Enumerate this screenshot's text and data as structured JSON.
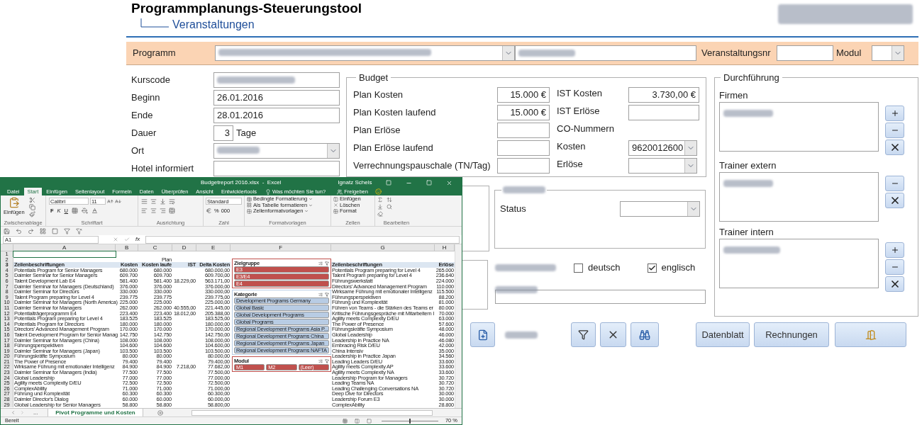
{
  "app": {
    "title": "Programmplanungs-Steuerungstool",
    "subtitle": "Veranstaltungen"
  },
  "header_bar": {
    "program_label": "Programm",
    "event_no_label": "Veranstaltungsnr",
    "module_label": "Modul"
  },
  "details": [
    {
      "label": "Kurscode",
      "kind": "text",
      "blurred": true
    },
    {
      "label": "Beginn",
      "kind": "text",
      "value": "26.01.2016"
    },
    {
      "label": "Ende",
      "kind": "text",
      "value": "28.01.2016"
    },
    {
      "label": "Dauer",
      "kind": "days",
      "value": "3",
      "unit": "Tage"
    },
    {
      "label": "Ort",
      "kind": "combo",
      "blurred": true
    },
    {
      "label": "Hotel informiert",
      "kind": "text"
    }
  ],
  "budget": {
    "title": "Budget",
    "plan_rows": [
      {
        "label": "Plan Kosten",
        "value": "15.000 €"
      },
      {
        "label": "Plan Kosten laufend",
        "value": "15.000 €"
      },
      {
        "label": "Plan Erlöse"
      },
      {
        "label": "Plan Erlöse laufend"
      },
      {
        "label": "Verrechnungspauschale (TN/Tag)"
      }
    ],
    "actual_rows": [
      {
        "label": "IST Kosten",
        "kind": "field",
        "value": "3.730,00 €"
      },
      {
        "label": "IST Erlöse",
        "kind": "field"
      },
      {
        "label": "CO-Nummern",
        "kind": "heading"
      },
      {
        "label": "Kosten",
        "kind": "combo",
        "value": "9620012600"
      },
      {
        "label": "Erlöse",
        "kind": "combo"
      }
    ]
  },
  "status_group": {
    "status_label": "Status"
  },
  "languages": [
    {
      "label": "deutsch",
      "checked": false
    },
    {
      "label": "englisch",
      "checked": true
    }
  ],
  "execution": {
    "title": "Durchführung",
    "lists": [
      {
        "label": "Firmen",
        "buttons": [
          {
            "kind": "add"
          },
          {
            "kind": "remove"
          },
          {
            "kind": "delete"
          }
        ]
      },
      {
        "label": "Trainer extern",
        "buttons": [
          {
            "kind": "remove"
          },
          {
            "kind": "delete"
          }
        ]
      },
      {
        "label": "Trainer intern",
        "buttons": [
          {
            "kind": "add"
          },
          {
            "kind": "remove"
          },
          {
            "kind": "delete"
          }
        ]
      }
    ]
  },
  "bottom_buttons": [
    {
      "kind": "new"
    },
    {
      "kind": "filter"
    },
    {
      "kind": "clear"
    },
    {
      "kind": "find"
    },
    {
      "kind": "text",
      "label": "Datenblatt"
    },
    {
      "kind": "text",
      "label": "Rechnungen"
    },
    {
      "kind": "exit"
    }
  ],
  "excel": {
    "title": "Budgetreport 2016.xlsx  -  Excel",
    "user": "Ignatz Schels",
    "tabs": [
      {
        "label": "Datei",
        "selected": false
      },
      {
        "label": "Start",
        "selected": true
      },
      {
        "label": "Einfügen",
        "selected": false
      },
      {
        "label": "Seitenlayout",
        "selected": false
      },
      {
        "label": "Formeln",
        "selected": false
      },
      {
        "label": "Daten",
        "selected": false
      },
      {
        "label": "Überprüfen",
        "selected": false
      },
      {
        "label": "Ansicht",
        "selected": false
      },
      {
        "label": "Entwicklertools",
        "selected": false
      }
    ],
    "search_hint": "Was möchten Sie tun?",
    "share": "Freigeben",
    "ribbon": {
      "paste": "Einfügen",
      "font": "Calibri",
      "size": "11",
      "bold": "F",
      "italic": "K",
      "underline": "U",
      "number_format": "Standard",
      "percent": "%",
      "thousands": "000",
      "styles": [
        "Bedingte Formatierung",
        "Als Tabelle formatieren",
        "Zellenformatvorlagen"
      ],
      "cells": [
        "Einfügen",
        "Löschen",
        "Format"
      ],
      "groups": [
        "Zwischenablage",
        "Schriftart",
        "Ausrichtung",
        "Zahl",
        "Formatvorlagen",
        "Zellen",
        "Bearbeiten"
      ]
    },
    "name_box": "A1",
    "formula_label": "fx",
    "columns": [
      "A",
      "B",
      "C",
      "D",
      "E",
      "F",
      "G",
      "H"
    ],
    "rows": [
      {
        "number": "1"
      },
      {
        "number": "2",
        "c": "Plan"
      },
      {
        "number": "3",
        "kind": "header",
        "a": "Zeilenbeschriftungen",
        "b": "Kosten",
        "c": "Kosten laufe",
        "d": "IST",
        "e": "Delta Kosten",
        "g": "Zeilenbeschriftungen",
        "h": "Erlöse"
      },
      {
        "number": "4",
        "a": "Potentials Program for Senior Managers",
        "b": "680.000",
        "c": "680.000",
        "e": "680.000,00",
        "g": "Potentials Program preparing for Level 4",
        "h": "265.000"
      },
      {
        "number": "5",
        "a": "Daimler Seminar for Senior Managers",
        "b": "609.700",
        "c": "609.700",
        "e": "609.700,00",
        "g": "Talent Program preparing for Level 4",
        "h": "236.640"
      },
      {
        "number": "6",
        "a": "Talent Development Lab E4",
        "b": "581.400",
        "c": "581.400",
        "d": "18.229,00",
        "e": "563.171,00",
        "g": "Führungswerkstatt",
        "h": "224.000"
      },
      {
        "number": "7",
        "a": "Daimler Seminar for Managers (Deutschland)",
        "b": "376.000",
        "c": "376.000",
        "e": "376.000,00",
        "g": "Directors' Advanced Management Program",
        "h": "110.000"
      },
      {
        "number": "8",
        "a": "Daimler Seminar for Directors",
        "b": "330.000",
        "c": "330.000",
        "e": "330.000,00",
        "g": "Wirksame Führung mit emotionaler Intelligenz",
        "h": "115.500"
      },
      {
        "number": "9",
        "a": "Talent Program preparing for Level 4",
        "b": "239.775",
        "c": "239.775",
        "e": "239.775,00",
        "g": "Führungsperspektiven",
        "h": "88.200"
      },
      {
        "number": "10",
        "a": "Daimler Seminar for Managers (North America)",
        "b": "225.000",
        "c": "225.000",
        "e": "225.000,00",
        "g": "Führung und Komplexität",
        "h": "81.000"
      },
      {
        "number": "11",
        "a": "Daimler Seminar for Managers",
        "b": "262.000",
        "c": "262.000",
        "d": "40.555,00",
        "e": "221.445,00",
        "g": "Führen von Teams - die Stärken des Teams er",
        "h": "80.000"
      },
      {
        "number": "12",
        "a": "Potentialträgerprogramm E4",
        "b": "223.400",
        "c": "223.400",
        "d": "18.012,00",
        "e": "205.388,00",
        "g": "Kritische Führungsgespräche mit Mitarbeitern I",
        "h": "70.000"
      },
      {
        "number": "13",
        "a": "Potentials Program preparing for Level 4",
        "b": "183.525",
        "c": "183.525",
        "e": "183.525,00",
        "g": "Agility meets Complexity D/EU",
        "h": "63.000"
      },
      {
        "number": "14",
        "a": "Potentials Program for Directors",
        "b": "180.000",
        "c": "180.000",
        "e": "180.000,00",
        "g": "The Power of Presence",
        "h": "57.600"
      },
      {
        "number": "15",
        "a": "Directors' Advanced Management Program",
        "b": "170.000",
        "c": "170.000",
        "e": "170.000,00",
        "g": "Führungskräfte Symposium",
        "h": "48.000"
      },
      {
        "number": "16",
        "a": "Talent Development Program for Senior Manag",
        "b": "142.750",
        "c": "142.750",
        "e": "142.750,00",
        "g": "Global Leadership",
        "h": "46.000"
      },
      {
        "number": "17",
        "a": "Daimler Seminar for Managers (China)",
        "b": "108.000",
        "c": "108.000",
        "e": "108.000,00",
        "g": "Leadership in Practice NA",
        "h": "46.080"
      },
      {
        "number": "18",
        "a": "Führungsperspektiven",
        "b": "104.600",
        "c": "104.600",
        "e": "104.600,00",
        "g": "Embracing Risk D/EU",
        "h": "42.000"
      },
      {
        "number": "19",
        "a": "Daimler Seminar for Managers (Japan)",
        "b": "103.500",
        "c": "103.500",
        "e": "103.500,00",
        "g": "China Intensiv",
        "h": "35.000"
      },
      {
        "number": "20",
        "a": "Führungskräfte Symposium",
        "b": "80.000",
        "c": "80.000",
        "e": "80.000,00",
        "g": "Leadership in Practice Japan",
        "h": "34.560"
      },
      {
        "number": "21",
        "a": "The Power of Presence",
        "b": "79.400",
        "c": "79.400",
        "e": "79.400,00",
        "g": "Leading Leaders D/EU",
        "h": "33.600"
      },
      {
        "number": "22",
        "a": "Wirksame Führung mit emotionaler Intelligenz",
        "b": "84.900",
        "c": "84.900",
        "d": "7.218,00",
        "e": "77.682,00",
        "g": "Agility meets Complexity AP",
        "h": "33.600"
      },
      {
        "number": "23",
        "a": "Daimler Seminar for Managers (India)",
        "b": "77.500",
        "c": "77.500",
        "e": "77.500,00",
        "g": "Agility meets Complexity NA",
        "h": "33.600"
      },
      {
        "number": "24",
        "a": "Global Leadership",
        "b": "77.000",
        "c": "77.000",
        "e": "77.000,00",
        "g": "Leadership Program for Managers",
        "h": "30.720"
      },
      {
        "number": "25",
        "a": "Agility meets Complexity D/EU",
        "b": "72.500",
        "c": "72.500",
        "e": "72.500,00",
        "g": "Leading Teams NA",
        "h": "30.720"
      },
      {
        "number": "26",
        "a": "ComplexAbility",
        "b": "71.000",
        "c": "71.000",
        "e": "71.000,00",
        "g": "Leading Challenging Conversations NA",
        "h": "30.720"
      },
      {
        "number": "27",
        "a": "Führung und Komplexität",
        "b": "60.300",
        "c": "60.300",
        "e": "60.300,00",
        "g": "Deep Dive for Directors",
        "h": "30.000"
      },
      {
        "number": "28",
        "a": "Daimler Director's Dialog",
        "b": "60.000",
        "c": "60.000",
        "e": "60.000,00",
        "g": "Leadership Forum E3",
        "h": "30.000"
      },
      {
        "number": "29",
        "a": "Global Leadership for Senior Managers",
        "b": "58.800",
        "c": "58.800",
        "e": "58.800,00",
        "g": "ComplexAbility",
        "h": "28.800"
      }
    ],
    "slicers": [
      {
        "title": "Zielgruppe",
        "color": "#c0504d",
        "kind": "list",
        "items": [
          {
            "label": "E3",
            "selected": true
          },
          {
            "label": "E3/E4",
            "selected": true
          },
          {
            "label": "E4",
            "selected": true
          }
        ]
      },
      {
        "title": "Kategorie",
        "color": "#b8cce4",
        "kind": "list",
        "items": [
          {
            "label": "Development Programs Germany",
            "selected": true
          },
          {
            "label": "Global Basic",
            "selected": true
          },
          {
            "label": "Global Development Programs",
            "selected": true
          },
          {
            "label": "Global Programs",
            "selected": true
          },
          {
            "label": "Regional Development Programs Asia P...",
            "selected": true
          },
          {
            "label": "Regional Development Programs China",
            "selected": true
          },
          {
            "label": "Regional Development Programs Japan",
            "selected": true
          },
          {
            "label": "Regional Development Programs NAFTA",
            "selected": true
          }
        ]
      },
      {
        "title": "Modul",
        "color": "#c0504d",
        "kind": "row",
        "items": [
          {
            "label": "M1",
            "selected": true
          },
          {
            "label": "M2",
            "selected": true
          },
          {
            "label": "(Leer)",
            "selected": true
          }
        ]
      }
    ],
    "sheet_tabs": [
      {
        "label": "...",
        "selected": false
      },
      {
        "label": "Pivot Programme und Kosten",
        "selected": true
      }
    ],
    "status": "Bereit",
    "zoom": "70 %",
    "zoom_slider": {
      "level": 0.5
    }
  }
}
